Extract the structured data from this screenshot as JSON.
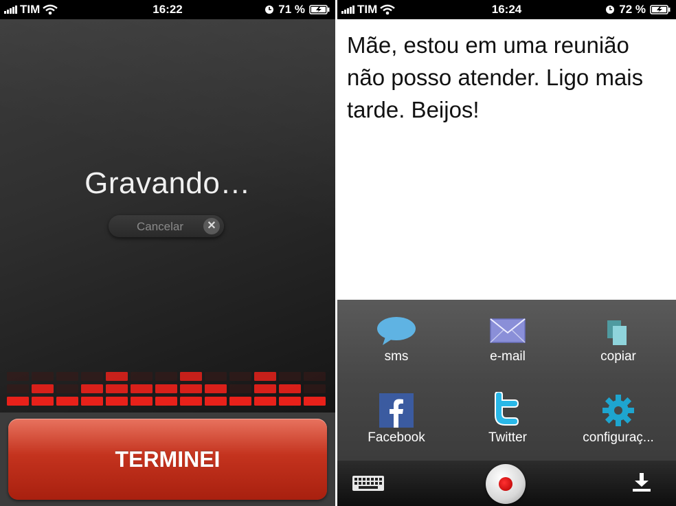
{
  "left_screen": {
    "status": {
      "carrier": "TIM",
      "time": "16:22",
      "battery": "71 %"
    },
    "title": "Gravando…",
    "cancel_label": "Cancelar",
    "finish_label": "TERMINEI",
    "equalizer_levels": [
      1,
      2,
      1,
      2,
      3,
      2,
      2,
      3,
      2,
      1,
      3,
      2,
      1
    ],
    "accent_color": "#c4331e"
  },
  "right_screen": {
    "status": {
      "carrier": "TIM",
      "time": "16:24",
      "battery": "72 %"
    },
    "message": "Mãe, estou em uma reunião não posso atender. Ligo mais tarde. Beijos!",
    "share": {
      "sms": "sms",
      "email": "e-mail",
      "copy": "copiar",
      "facebook": "Facebook",
      "twitter": "Twitter",
      "settings": "configuraç..."
    },
    "icons": [
      "sms-bubble-icon",
      "mail-icon",
      "copy-icon",
      "facebook-icon",
      "twitter-icon",
      "gear-icon",
      "keyboard-icon",
      "record-icon",
      "download-icon"
    ]
  }
}
